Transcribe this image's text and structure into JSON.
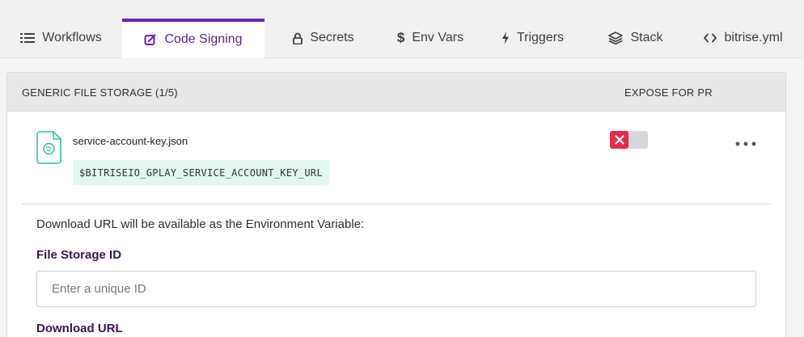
{
  "tabs": [
    {
      "label": "Workflows",
      "icon": "list-icon",
      "active": false
    },
    {
      "label": "Code Signing",
      "icon": "edit-icon",
      "active": true
    },
    {
      "label": "Secrets",
      "icon": "lock-icon",
      "active": false
    },
    {
      "label": "Env Vars",
      "icon": "dollar-icon",
      "active": false
    },
    {
      "label": "Triggers",
      "icon": "lightning-icon",
      "active": false
    },
    {
      "label": "Stack",
      "icon": "layers-icon",
      "active": false
    },
    {
      "label": "bitrise.yml",
      "icon": "code-icon",
      "active": false
    }
  ],
  "panel": {
    "title": "GENERIC FILE STORAGE (1/5)",
    "expose_label": "EXPOSE FOR PR",
    "file": {
      "name": "service-account-key.json",
      "env_var": "$BITRISEIO_GPLAY_SERVICE_ACCOUNT_KEY_URL",
      "expose_for_pr": false
    },
    "help_text": "Download URL will be available as the Environment Variable:",
    "storage_id_label": "File Storage ID",
    "storage_id_placeholder": "Enter a unique ID",
    "storage_id_value": "",
    "download_url_label": "Download URL"
  },
  "colors": {
    "accent": "#6b22c2",
    "toggle_off": "#e52b4a",
    "env_chip_bg": "#e3f7f1",
    "file_icon": "#2fc29b"
  }
}
